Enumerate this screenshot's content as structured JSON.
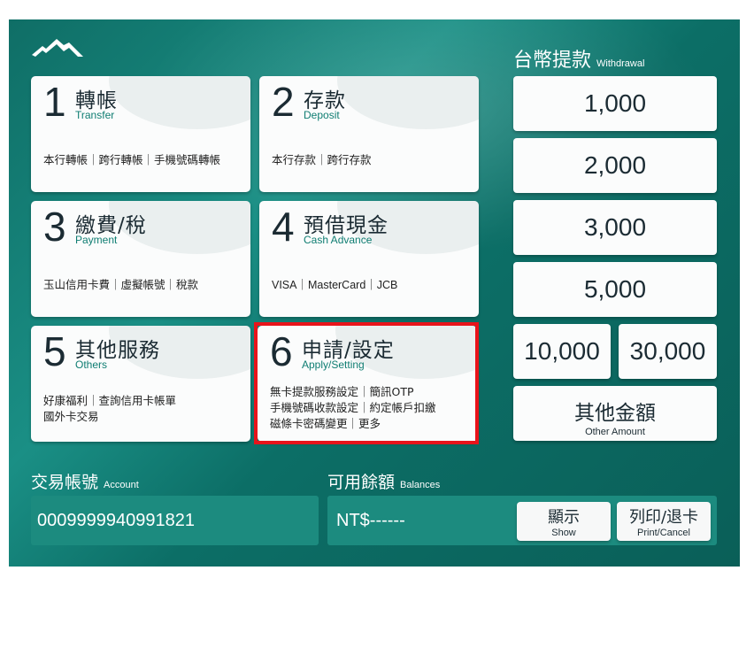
{
  "menu": [
    {
      "num": "1",
      "title": "轉帳",
      "sub": "Transfer",
      "desc": [
        "本行轉帳｜跨行轉帳｜手機號碼轉帳"
      ]
    },
    {
      "num": "2",
      "title": "存款",
      "sub": "Deposit",
      "desc": [
        "本行存款｜跨行存款"
      ]
    },
    {
      "num": "3",
      "title": "繳費/稅",
      "sub": "Payment",
      "desc": [
        "玉山信用卡費｜虛擬帳號｜稅款"
      ]
    },
    {
      "num": "4",
      "title": "預借現金",
      "sub": "Cash Advance",
      "desc": [
        "VISA｜MasterCard｜JCB"
      ]
    },
    {
      "num": "5",
      "title": "其他服務",
      "sub": "Others",
      "desc": [
        "好康福利｜查詢信用卡帳單",
        "國外卡交易"
      ]
    },
    {
      "num": "6",
      "title": "申請/設定",
      "sub": "Apply/Setting",
      "desc": [
        "無卡提款服務設定｜簡訊OTP",
        "手機號碼收款設定｜約定帳戶扣繳",
        "磁條卡密碼變更｜更多"
      ]
    }
  ],
  "withdrawal": {
    "title": "台幣提款",
    "title_en": "Withdrawal",
    "amounts": [
      "1,000",
      "2,000",
      "3,000",
      "5,000",
      "10,000",
      "30,000"
    ],
    "other": "其他金額",
    "other_en": "Other Amount"
  },
  "account": {
    "label": "交易帳號",
    "label_en": "Account",
    "value": "0009999940991821"
  },
  "balance": {
    "label": "可用餘額",
    "label_en": "Balances",
    "value": "NT$------"
  },
  "buttons": {
    "show": "顯示",
    "show_en": "Show",
    "print": "列印/退卡",
    "print_en": "Print/Cancel"
  },
  "colors": {
    "bg": "#0f6e66",
    "accent": "#0f7d72",
    "highlight": "#e8141b"
  }
}
